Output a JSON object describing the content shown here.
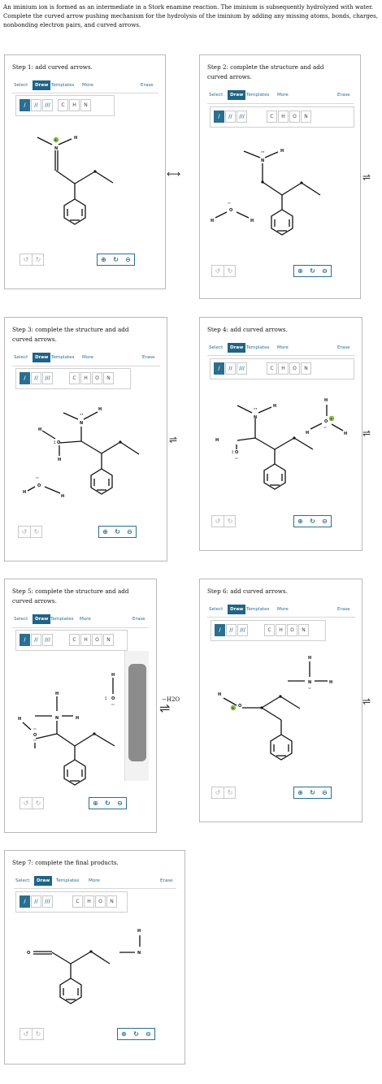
{
  "intro": "An iminium ion is formed as an intermediate in a Stork enamine reaction. The iminium is subsequently hydrolyzed with water. Complete the curved arrow pushing mechanism for the hydrolysis of the iminium by adding any missing atoms, bonds, charges, nonbonding electron pairs, and curved arrows.",
  "toolbar": {
    "select": "Select",
    "draw": "Draw",
    "templates": "Templates",
    "more": "More",
    "erase": "Erase",
    "bond_single": "/",
    "bond_double": "//",
    "bond_triple": "///",
    "atom_c": "C",
    "atom_h": "H",
    "atom_o": "O",
    "atom_n": "N",
    "undo_icon": "undo-icon",
    "redo_icon": "redo-icon",
    "zoom_in_icon": "zoom-in-icon",
    "zoom_reset_icon": "zoom-reset-icon",
    "zoom_out_icon": "zoom-out-icon"
  },
  "steps": [
    {
      "title": "Step 1: add curved arrows."
    },
    {
      "title": "Step 2: complete the structure and add curved arrows."
    },
    {
      "title": "Step 3: complete the structure and add curved arrows."
    },
    {
      "title": "Step 4: add curved arrows."
    },
    {
      "title": "Step 5: complete the structure and add curved arrows."
    },
    {
      "title": "Step 6: add curved arrows."
    },
    {
      "title": "Step 7: complete the final products."
    }
  ],
  "atoms": {
    "N": "N",
    "O": "O",
    "H": "H",
    "plus": "+",
    "lonepair": ":",
    "dots": "··"
  },
  "between": {
    "resonance": "⟷",
    "equilibrium": "⇌",
    "minus_water": "−H2O"
  }
}
